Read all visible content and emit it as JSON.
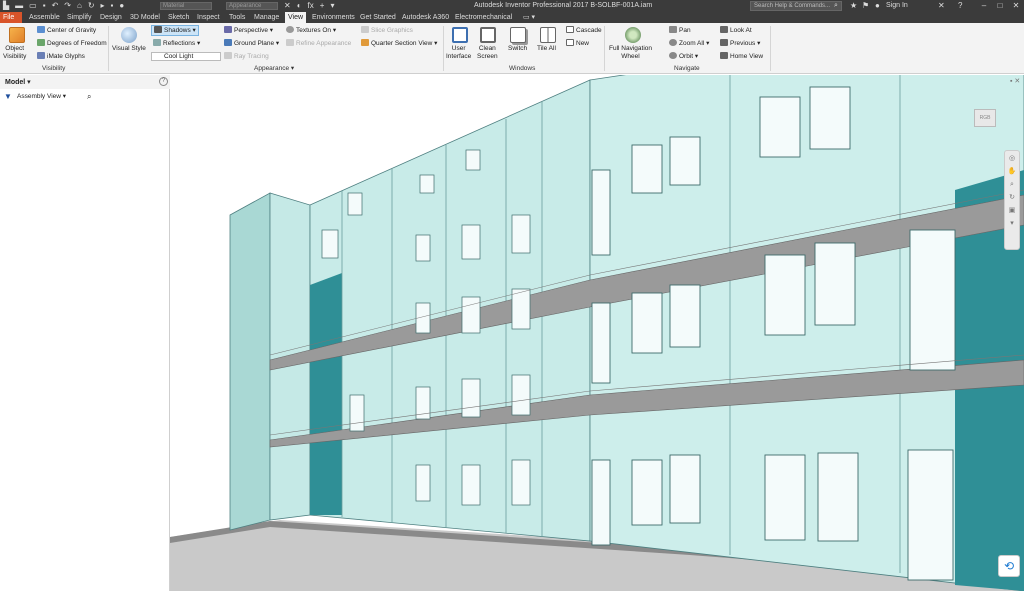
{
  "app": {
    "title": "Autodesk Inventor Professional 2017   B-SOLBF-001A.iam"
  },
  "quick_access": {
    "material_combo": "Material",
    "appearance_combo": "Appearance",
    "fx": "fx"
  },
  "titlebar": {
    "search_placeholder": "Search Help & Commands...",
    "sign_in": "Sign In"
  },
  "tabs": [
    {
      "label": "File"
    },
    {
      "label": "Assemble"
    },
    {
      "label": "Simplify"
    },
    {
      "label": "Design"
    },
    {
      "label": "3D Model"
    },
    {
      "label": "Sketch"
    },
    {
      "label": "Inspect"
    },
    {
      "label": "Tools"
    },
    {
      "label": "Manage"
    },
    {
      "label": "View"
    },
    {
      "label": "Environments"
    },
    {
      "label": "Get Started"
    },
    {
      "label": "Autodesk A360"
    },
    {
      "label": "Electromechanical"
    }
  ],
  "ribbon": {
    "visibility": {
      "object_visibility": "Object\nVisibility",
      "center_of_gravity": "Center of Gravity",
      "degrees_of_freedom": "Degrees of Freedom",
      "imate_glyphs": "iMate Glyphs",
      "panel_label": "Visibility"
    },
    "appearance": {
      "visual_style": "Visual Style",
      "shadows": "Shadows",
      "reflections": "Reflections",
      "lighting": "Cool Light",
      "perspective": "Perspective",
      "ground_plane": "Ground Plane",
      "ray_tracing": "Ray Tracing",
      "textures_on": "Textures On",
      "refine_appearance": "Refine Appearance",
      "slice_graphics": "Slice Graphics",
      "quarter_section_view": "Quarter Section View",
      "panel_label": "Appearance"
    },
    "windows": {
      "user_interface": "User\nInterface",
      "clean_screen": "Clean\nScreen",
      "switch": "Switch",
      "tile_all": "Tile All",
      "cascade": "Cascade",
      "new": "New",
      "panel_label": "Windows"
    },
    "navigate": {
      "full_navigation_wheel": "Full Navigation\nWheel",
      "pan": "Pan",
      "zoom_all": "Zoom All",
      "orbit": "Orbit",
      "look_at": "Look At",
      "previous": "Previous",
      "home_view": "Home View",
      "panel_label": "Navigate"
    }
  },
  "browser": {
    "title": "Model",
    "view_mode": "Assembly View",
    "help": "?"
  },
  "viewport": {
    "viewcube_label": "RGB"
  },
  "colors": {
    "title_bg": "#3b3b3b",
    "file_tab": "#d9542a",
    "ribbon_bg": "#f3f3f3",
    "wall": "#bfe3e0",
    "wall_dark": "#2f8f96",
    "slab": "#9a9a9a"
  }
}
